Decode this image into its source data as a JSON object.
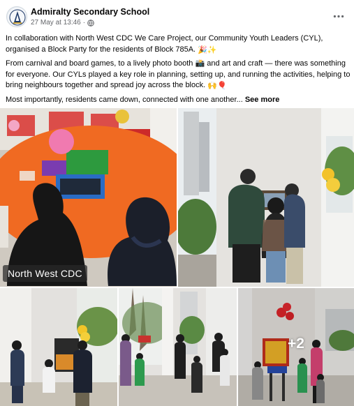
{
  "post": {
    "page_name": "Admiralty Secondary School",
    "timestamp": "27 May at 13:46",
    "meta_separator": "·",
    "privacy_icon": "globe-icon",
    "more_options_icon": "ellipsis-icon",
    "paragraphs": [
      {
        "text": "In collaboration with North West CDC We Care Project, our Community Youth Leaders (CYL), organised a Block Party for the residents of Block 785A.",
        "emoji": "🎉✨"
      },
      {
        "text": "From carnival and board games, to a lively photo booth 📸 and art and craft — there was something for everyone. Our CYLs played a key role in planning, setting up, and running the activities, helping to bring neighbours together and spread joy across the block.",
        "emoji": "🙌🎈"
      },
      {
        "text": "Most importantly, residents came down, connected with one another...",
        "see_more": "See more"
      }
    ]
  },
  "photos": {
    "watermark": "North West CDC",
    "more_count": "+2"
  }
}
